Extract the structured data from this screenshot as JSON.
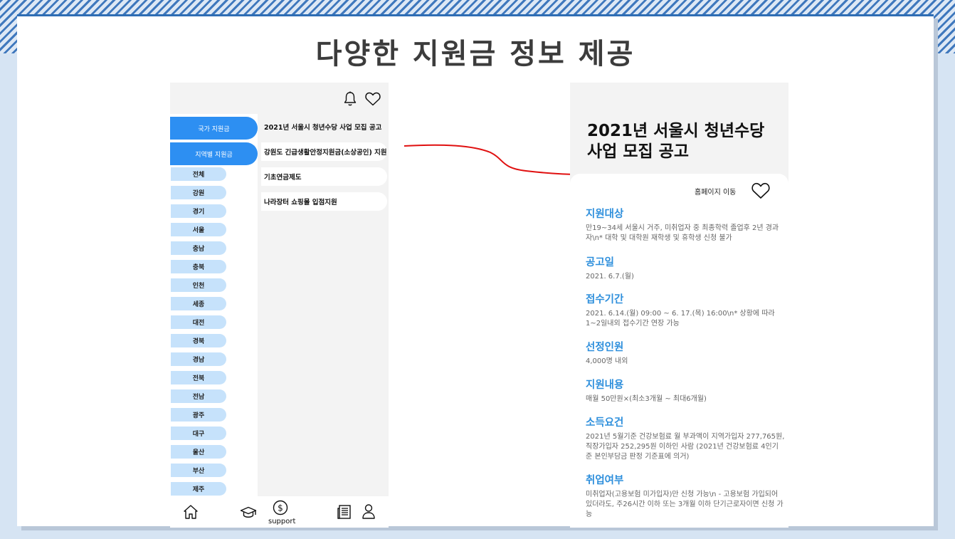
{
  "slide": {
    "title": "다양한 지원금 정보 제공"
  },
  "left_screen": {
    "top_icons": [
      "bell-icon",
      "heart-icon"
    ],
    "categories": [
      {
        "label": "국가 지원금"
      },
      {
        "label": "지역별 지원금"
      }
    ],
    "regions": [
      "전체",
      "강원",
      "경기",
      "서울",
      "충남",
      "충북",
      "인천",
      "세종",
      "대전",
      "경북",
      "경남",
      "전북",
      "전남",
      "광주",
      "대구",
      "울산",
      "부산",
      "제주"
    ],
    "list_items": [
      "2021년 서울시 청년수당 사업 모집 공고",
      "강원도 긴급생활안정지원금(소상공인) 지원",
      "기초연금제도",
      "나라장터 쇼핑몰 입점지원"
    ],
    "bottom_nav": {
      "icons": [
        "home-icon",
        "graduation-cap-icon",
        "dollar-circle-icon",
        "newspaper-icon",
        "user-icon"
      ],
      "support_label": "support"
    }
  },
  "right_screen": {
    "title": "2021년 서울시 청년수당 사업 모집 공고",
    "homepage_link": "홈페이지 이동",
    "sections": [
      {
        "heading": "지원대상",
        "body": "만19~34세 서울시 거주, 미취업자 중 최종학력 졸업후 2년 경과자\\n* 대학 및 대학원 재학생 및 휴학생 신청 불가"
      },
      {
        "heading": "공고일",
        "body": "2021. 6.7.(월)"
      },
      {
        "heading": "접수기간",
        "body": "2021. 6.14.(월) 09:00 ~ 6. 17.(목) 16:00\\n* 상황에 따라 1~2일내외 접수기간 연장 가능"
      },
      {
        "heading": "선정인원",
        "body": "4,000명 내외"
      },
      {
        "heading": "지원내용",
        "body": "매월 50만원×(최소3개월 ~ 최대6개월)"
      },
      {
        "heading": "소득요건",
        "body": "2021년 5월기준 건강보험료 월 부과액이 지역가입자 277,765원, 직장가입자 252,295원 이하인 사람 (2021년 건강보험료 4인기준 본인부담금 판정 기준표에 의거)"
      },
      {
        "heading": "취업여부",
        "body": "미취업자(고용보험 미가입자)만 신청 가능\\n - 고용보험 가입되어 있더라도, 주26시간 이하 또는 3개월 이하 단기근로자이면 신청 가능"
      }
    ]
  },
  "colors": {
    "primary_blue": "#2d8ff2",
    "light_blue": "#c6e2fb",
    "heading_blue": "#2e8fdc",
    "arrow_red": "#e01010",
    "title_gray": "#3c3c3c"
  }
}
